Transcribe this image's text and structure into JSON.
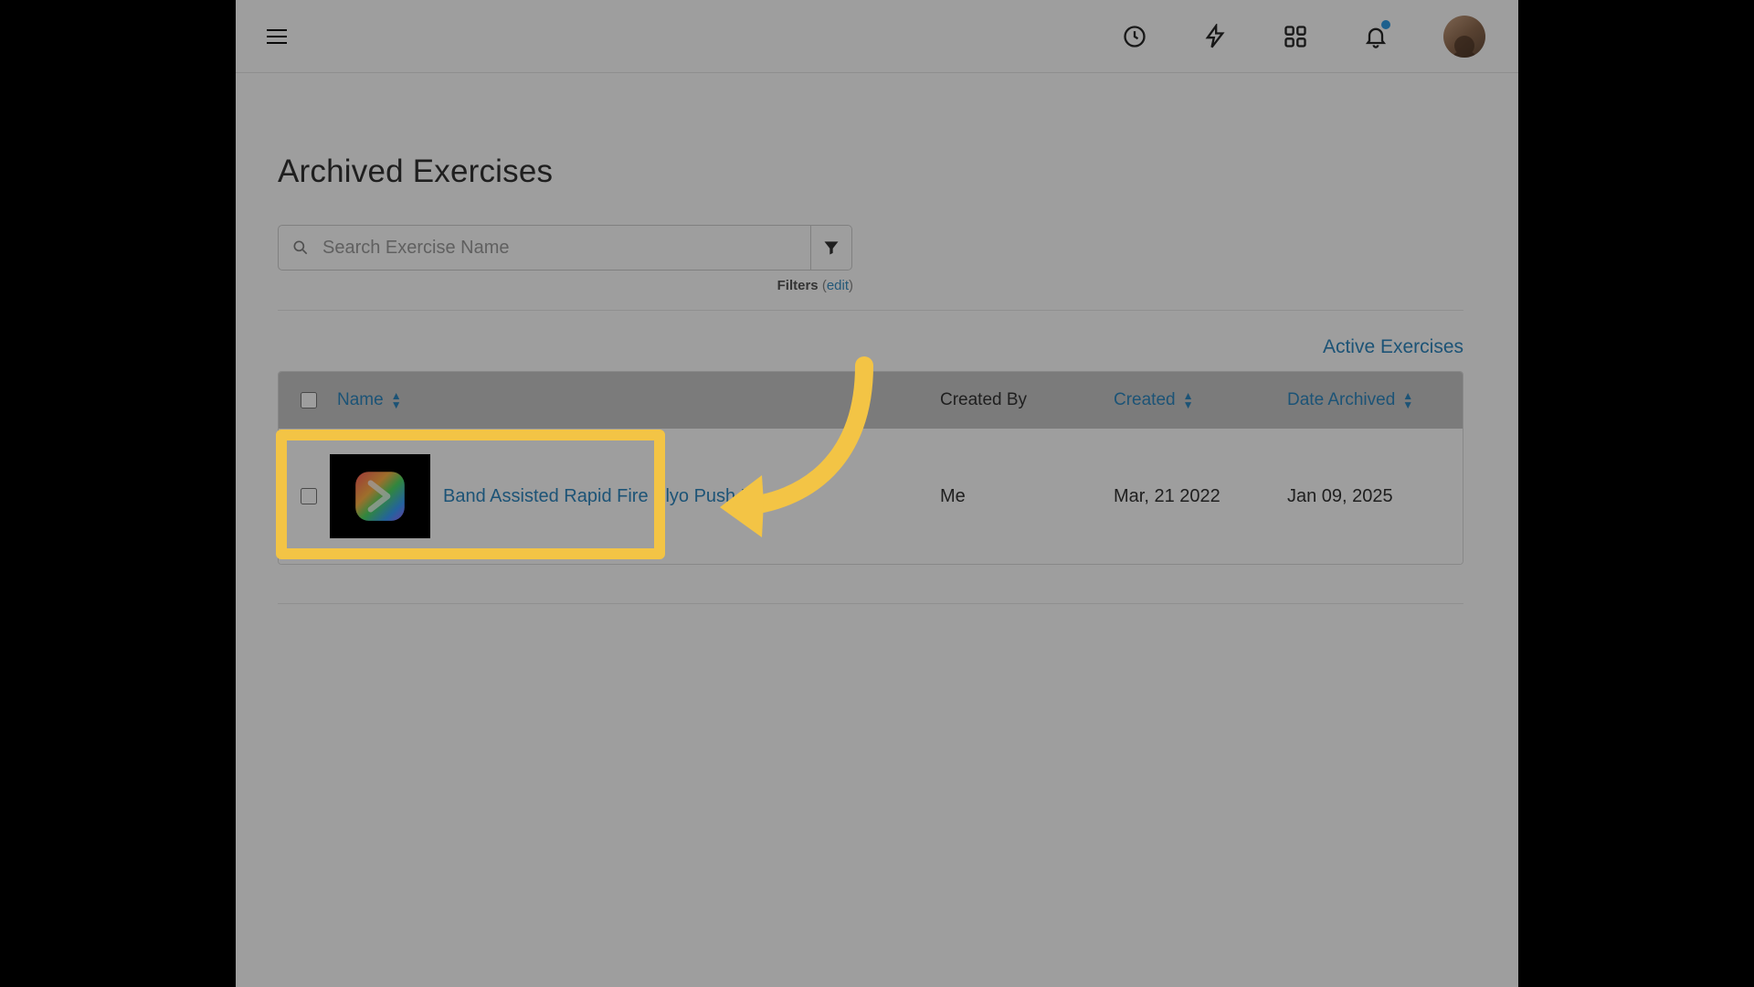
{
  "header": {
    "icons": [
      "clock",
      "bolt",
      "apps",
      "bell"
    ],
    "notification_dot": true
  },
  "page": {
    "title": "Archived Exercises",
    "search_placeholder": "Search Exercise Name",
    "filters_label": "Filters",
    "filters_edit": "edit",
    "active_link": "Active Exercises"
  },
  "table": {
    "columns": {
      "name": "Name",
      "created_by": "Created By",
      "created": "Created",
      "date_archived": "Date Archived"
    },
    "rows": [
      {
        "name": "Band Assisted Rapid Fire Plyo Push Up",
        "created_by": "Me",
        "created": "Mar, 21 2022",
        "date_archived": "Jan 09, 2025"
      }
    ]
  },
  "annotation": {
    "highlight_color": "#f3c445",
    "arrow_color": "#f3c445"
  }
}
